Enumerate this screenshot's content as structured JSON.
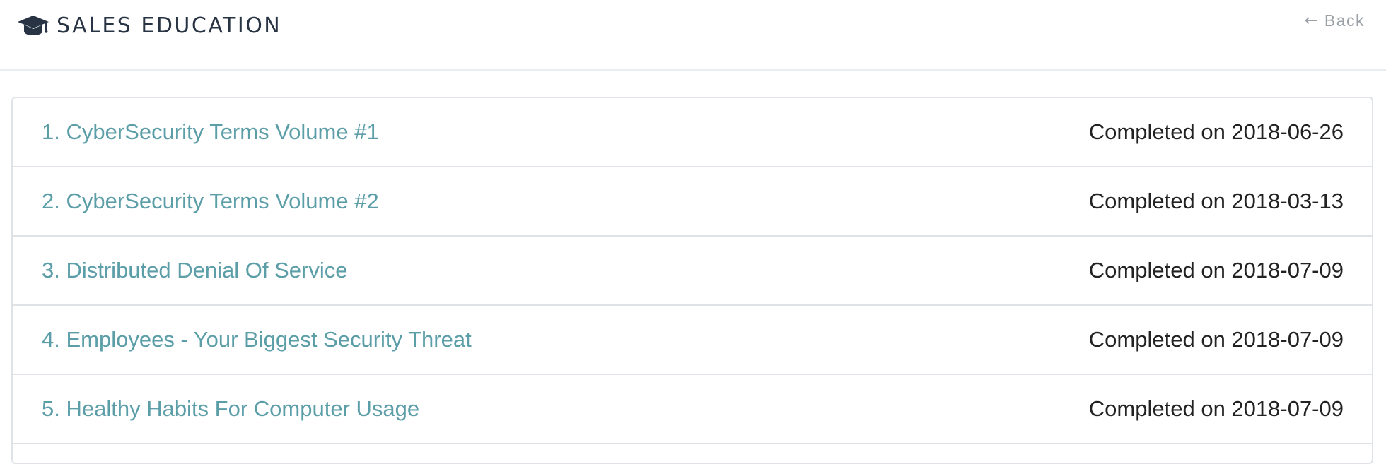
{
  "header": {
    "title": "SALES EDUCATION",
    "icon": "graduation-cap-icon",
    "back_label": "Back",
    "back_icon": "arrow-left-icon"
  },
  "courses": [
    {
      "title": "1. CyberSecurity Terms Volume #1",
      "status": "Completed on 2018-06-26"
    },
    {
      "title": "2. CyberSecurity Terms Volume #2",
      "status": "Completed on 2018-03-13"
    },
    {
      "title": "3. Distributed Denial Of Service",
      "status": "Completed on 2018-07-09"
    },
    {
      "title": "4. Employees - Your Biggest Security Threat",
      "status": "Completed on 2018-07-09"
    },
    {
      "title": "5. Healthy Habits For Computer Usage",
      "status": "Completed on 2018-07-09"
    }
  ],
  "colors": {
    "link": "#5c9ea8",
    "title": "#283443",
    "muted": "#9aa0a6",
    "border": "#dfe2e6"
  }
}
